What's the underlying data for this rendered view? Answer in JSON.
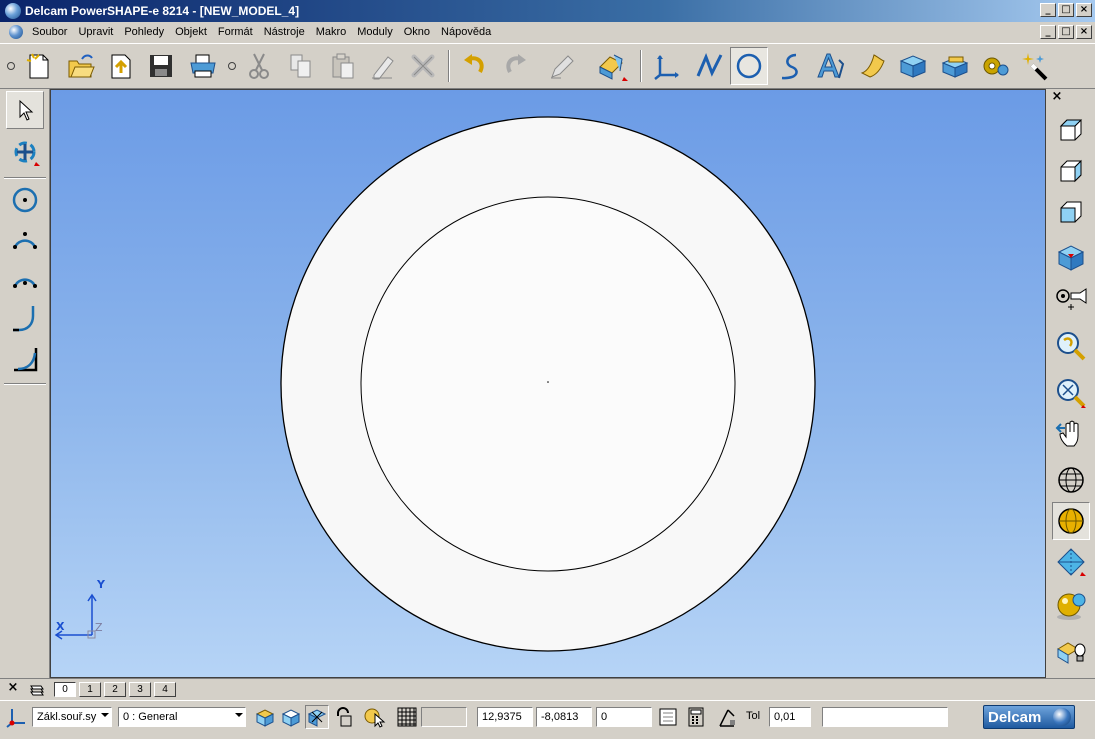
{
  "window": {
    "title": "Delcam PowerSHAPE-e 8214 - [NEW_MODEL_4]",
    "controls": [
      "_",
      "□",
      "×"
    ]
  },
  "menu": {
    "items": [
      {
        "label": "Soubor"
      },
      {
        "label": "Upravit"
      },
      {
        "label": "Pohledy"
      },
      {
        "label": "Objekt"
      },
      {
        "label": "Formát"
      },
      {
        "label": "Nástroje"
      },
      {
        "label": "Makro"
      },
      {
        "label": "Moduly"
      },
      {
        "label": "Okno"
      },
      {
        "label": "Nápověda"
      }
    ]
  },
  "toolbar": {
    "items": [
      "new-model-icon",
      "open-model-icon",
      "import-icon",
      "save-icon",
      "print-icon",
      "cut-icon",
      "copy-icon",
      "paste-icon",
      "erase-icon",
      "delete-icon",
      "undo-icon",
      "redo-icon",
      "edit-icon",
      "generic-edit-icon",
      "workplane-icon",
      "line-icon",
      "arc-icon",
      "curve-icon",
      "text-icon",
      "surface-icon",
      "solid-icon",
      "solid-feature-icon",
      "electrode-icon",
      "wizard-icon"
    ]
  },
  "left_toolbar": {
    "items": [
      "select-icon",
      "transform-icon",
      "arc-center-icon",
      "arc-three-points-icon",
      "arc-through-points-icon",
      "fillet-arc-icon",
      "corner-arc-icon"
    ]
  },
  "right_toolbar": {
    "items": [
      "view-iso1-icon",
      "view-iso2-icon",
      "view-iso3-icon",
      "view-top-icon",
      "view-camera-icon",
      "zoom-previous-icon",
      "zoom-fit-icon",
      "pan-icon",
      "wireframe-icon",
      "shaded-icon",
      "view-shading-icon",
      "sphere-icon",
      "lights-icon"
    ]
  },
  "viewport": {
    "axis": {
      "x": "X",
      "y": "Y",
      "z": "Z"
    }
  },
  "levels": {
    "tabs": [
      "0",
      "1",
      "2",
      "3",
      "4"
    ],
    "active": "0"
  },
  "status": {
    "workplane": "Zákl.souř.sy",
    "level": "0   : General",
    "x": "12,9375",
    "y": "-8,0813",
    "z": "0",
    "tol_label": "Tol",
    "tol_value": "0,01",
    "brand": "Delcam"
  }
}
